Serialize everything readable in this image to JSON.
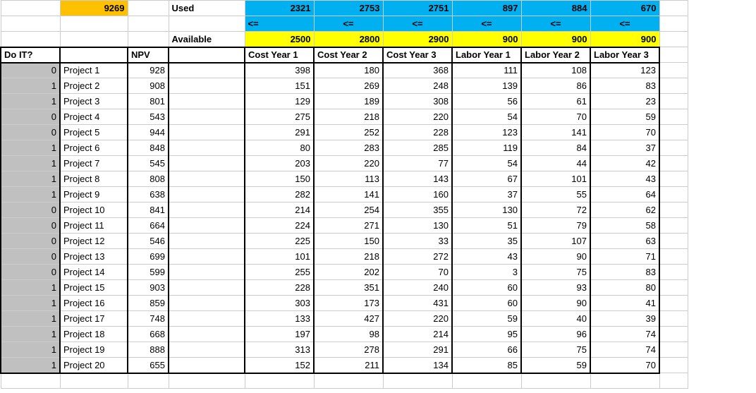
{
  "topValue": "9269",
  "usedLabel": "Used",
  "availableLabel": "Available",
  "lte": "<=",
  "used": [
    "2321",
    "2753",
    "2751",
    "897",
    "884",
    "670"
  ],
  "available": [
    "2500",
    "2800",
    "2900",
    "900",
    "900",
    "900"
  ],
  "doItHeader": "Do IT?",
  "npvHeader": "NPV",
  "colHeaders": [
    "Cost Year 1",
    "Cost Year 2",
    "Cost Year 3",
    "Labor Year 1",
    "Labor Year 2",
    "Labor Year 3"
  ],
  "rows": [
    {
      "d": "0",
      "p": "Project 1",
      "n": "928",
      "v": [
        "398",
        "180",
        "368",
        "111",
        "108",
        "123"
      ]
    },
    {
      "d": "1",
      "p": "Project 2",
      "n": "908",
      "v": [
        "151",
        "269",
        "248",
        "139",
        "86",
        "83"
      ]
    },
    {
      "d": "1",
      "p": "Project 3",
      "n": "801",
      "v": [
        "129",
        "189",
        "308",
        "56",
        "61",
        "23"
      ]
    },
    {
      "d": "0",
      "p": "Project 4",
      "n": "543",
      "v": [
        "275",
        "218",
        "220",
        "54",
        "70",
        "59"
      ]
    },
    {
      "d": "0",
      "p": "Project 5",
      "n": "944",
      "v": [
        "291",
        "252",
        "228",
        "123",
        "141",
        "70"
      ]
    },
    {
      "d": "1",
      "p": "Project 6",
      "n": "848",
      "v": [
        "80",
        "283",
        "285",
        "119",
        "84",
        "37"
      ]
    },
    {
      "d": "1",
      "p": "Project 7",
      "n": "545",
      "v": [
        "203",
        "220",
        "77",
        "54",
        "44",
        "42"
      ]
    },
    {
      "d": "1",
      "p": "Project 8",
      "n": "808",
      "v": [
        "150",
        "113",
        "143",
        "67",
        "101",
        "43"
      ]
    },
    {
      "d": "1",
      "p": "Project 9",
      "n": "638",
      "v": [
        "282",
        "141",
        "160",
        "37",
        "55",
        "64"
      ]
    },
    {
      "d": "0",
      "p": "Project 10",
      "n": "841",
      "v": [
        "214",
        "254",
        "355",
        "130",
        "72",
        "62"
      ]
    },
    {
      "d": "0",
      "p": "Project 11",
      "n": "664",
      "v": [
        "224",
        "271",
        "130",
        "51",
        "79",
        "58"
      ]
    },
    {
      "d": "0",
      "p": "Project 12",
      "n": "546",
      "v": [
        "225",
        "150",
        "33",
        "35",
        "107",
        "63"
      ]
    },
    {
      "d": "0",
      "p": "Project 13",
      "n": "699",
      "v": [
        "101",
        "218",
        "272",
        "43",
        "90",
        "71"
      ]
    },
    {
      "d": "0",
      "p": "Project 14",
      "n": "599",
      "v": [
        "255",
        "202",
        "70",
        "3",
        "75",
        "83"
      ]
    },
    {
      "d": "1",
      "p": "Project 15",
      "n": "903",
      "v": [
        "228",
        "351",
        "240",
        "60",
        "93",
        "80"
      ]
    },
    {
      "d": "1",
      "p": "Project 16",
      "n": "859",
      "v": [
        "303",
        "173",
        "431",
        "60",
        "90",
        "41"
      ]
    },
    {
      "d": "1",
      "p": "Project 17",
      "n": "748",
      "v": [
        "133",
        "427",
        "220",
        "59",
        "40",
        "39"
      ]
    },
    {
      "d": "1",
      "p": "Project 18",
      "n": "668",
      "v": [
        "197",
        "98",
        "214",
        "95",
        "96",
        "74"
      ]
    },
    {
      "d": "1",
      "p": "Project 19",
      "n": "888",
      "v": [
        "313",
        "278",
        "291",
        "66",
        "75",
        "74"
      ]
    },
    {
      "d": "1",
      "p": "Project 20",
      "n": "655",
      "v": [
        "152",
        "211",
        "134",
        "85",
        "59",
        "70"
      ]
    }
  ]
}
